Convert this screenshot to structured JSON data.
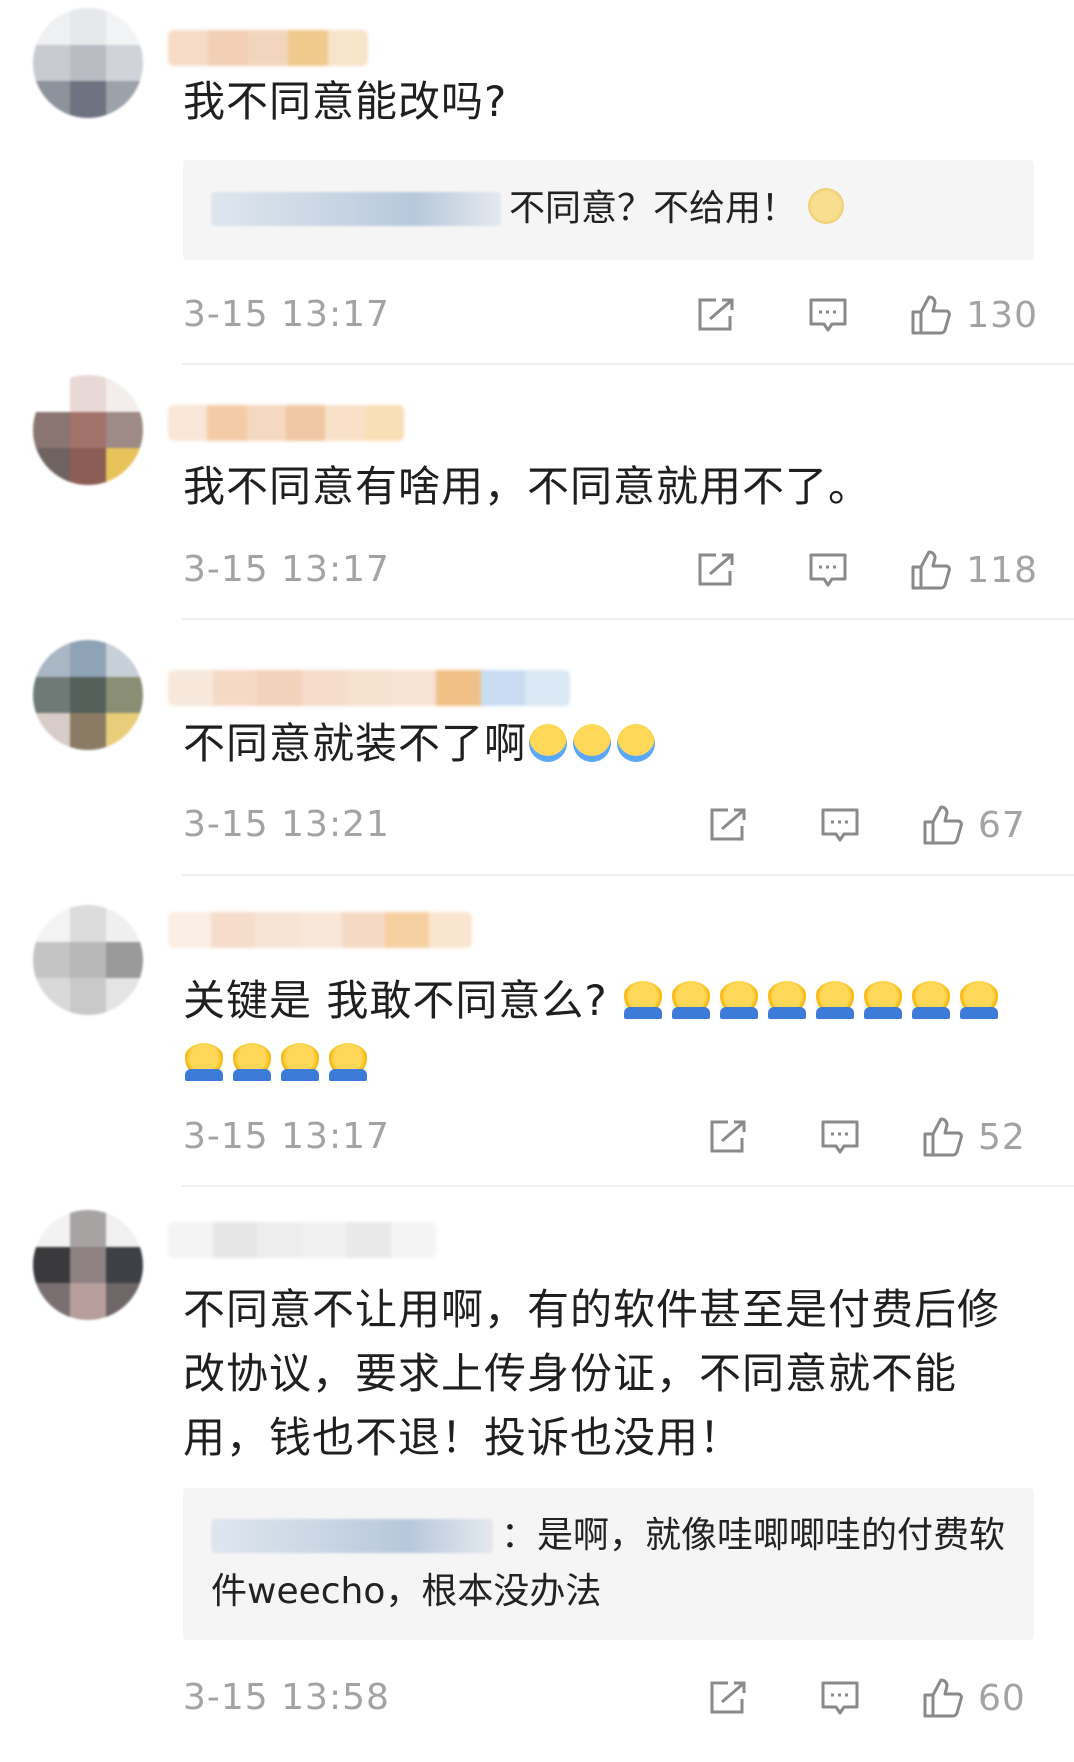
{
  "comments": [
    {
      "text": "我不同意能改吗?",
      "reply": {
        "text": "不同意？不给用！",
        "emoji": "doge-emoji"
      },
      "time": "3-15 13:17",
      "likes": "130"
    },
    {
      "text": "我不同意有啥用，不同意就用不了。",
      "time": "3-15 13:17",
      "likes": "118"
    },
    {
      "text": "不同意就装不了啊",
      "emoji": [
        "cry-laugh-emoji",
        "cry-laugh-emoji",
        "cry-laugh-emoji"
      ],
      "time": "3-15 13:21",
      "likes": "67"
    },
    {
      "text": "关键是 我敢不同意么?",
      "emoji_count": 12,
      "time": "3-15 13:17",
      "likes": "52"
    },
    {
      "text": "不同意不让用啊，有的软件甚至是付费后修改协议，要求上传身份证，不同意就不能用，钱也不退！投诉也没用！",
      "reply": {
        "text": "：是啊，就像哇唧唧哇的付费软件weecho，根本没办法"
      },
      "time": "3-15 13:58",
      "likes": "60"
    }
  ],
  "icons": {
    "share": "share-icon",
    "comment": "comment-icon",
    "like": "thumbs-up-icon"
  },
  "colors": {
    "meta_text": "#a3a3a3",
    "body_text": "#1f1f1f",
    "quote_bg": "#f5f5f5",
    "divider": "#efefef"
  }
}
